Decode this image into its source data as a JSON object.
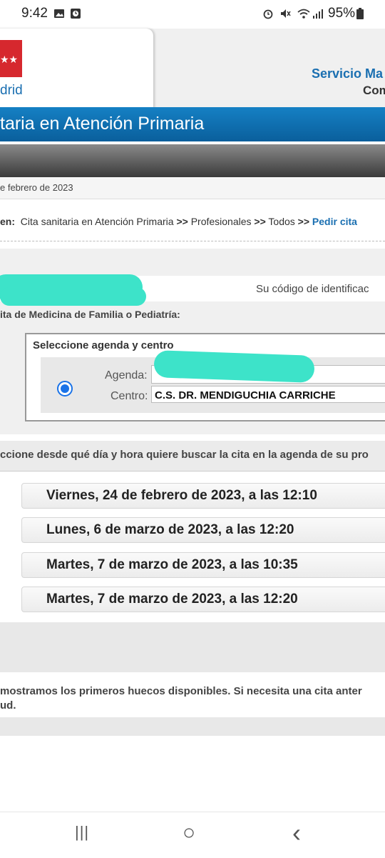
{
  "status_bar": {
    "time": "9:42",
    "battery": "95%"
  },
  "header": {
    "logo_text": "drid",
    "service_title": "Servicio Ma",
    "service_subtitle": "Com"
  },
  "banner": {
    "title": "taria en Atención Primaria"
  },
  "date_text": "e febrero de 2023",
  "breadcrumb": {
    "prefix": "en:",
    "item1": "Cita sanitaria en Atención Primaria",
    "sep": ">>",
    "item2": "Profesionales",
    "item3": "Todos",
    "current": "Pedir cita"
  },
  "id_label": "Su código de identificac",
  "medicina_label": "ita de Medicina de Familia o Pediatría:",
  "selector": {
    "title": "Seleccione agenda y centro",
    "agenda_label": "Agenda:",
    "centro_label": "Centro:",
    "centro_value": "C.S. DR. MENDIGUCHIA CARRICHE"
  },
  "instruction": "ccione desde qué día y hora quiere buscar la cita en la agenda de su pro",
  "slots": [
    "Viernes,  24 de febrero de 2023, a las 12:10",
    "Lunes,  6 de marzo de 2023, a las 12:20",
    "Martes,  7 de marzo de 2023, a las 10:35",
    "Martes,  7 de marzo de 2023, a las 12:20"
  ],
  "footnote": {
    "line1": "mostramos los primeros huecos disponibles. Si necesita una cita anter",
    "line2": "ud."
  },
  "nav": {
    "recents": "|||",
    "home": "○",
    "back": "‹"
  },
  "colors": {
    "brand_blue": "#1a6fb1",
    "banner": "#0a5f9c",
    "highlight_scribble": "#3de3c9",
    "logo_red": "#d6282e"
  }
}
